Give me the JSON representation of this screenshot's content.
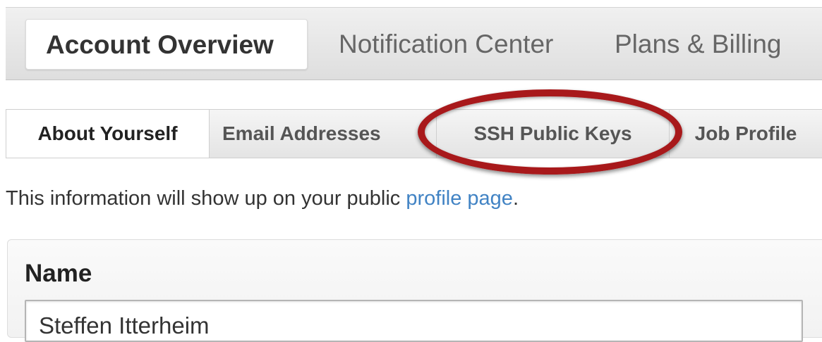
{
  "top_tabs": {
    "account_overview": "Account Overview",
    "notification_center": "Notification Center",
    "plans_billing": "Plans & Billing"
  },
  "sub_tabs": {
    "about_yourself": "About Yourself",
    "email_addresses": "Email Addresses",
    "ssh_public_keys": "SSH Public Keys",
    "job_profile": "Job Profile"
  },
  "info": {
    "text_before": "This information will show up on your public ",
    "link_text": "profile page",
    "text_after": "."
  },
  "name_section": {
    "label": "Name",
    "value": "Steffen Itterheim"
  },
  "colors": {
    "highlight": "#a8191b",
    "link": "#4183c4"
  }
}
